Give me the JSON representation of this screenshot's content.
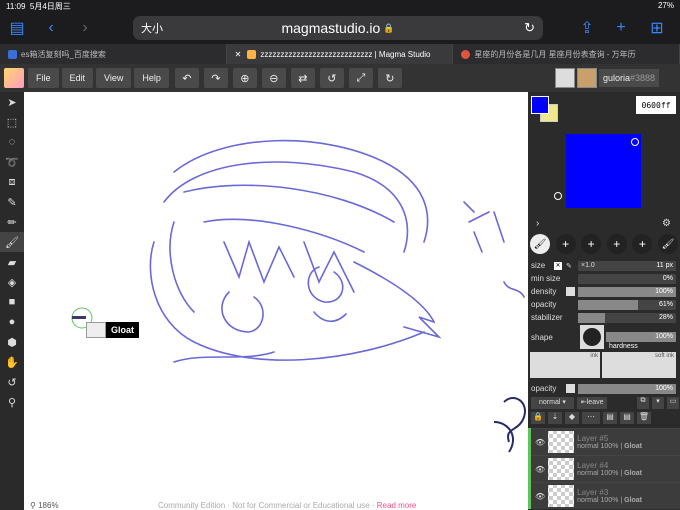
{
  "status": {
    "time": "11:09",
    "date": "5月4日周三",
    "battery": "27%"
  },
  "browser": {
    "aa": "大小",
    "url": "magmastudio.io",
    "tabs": [
      {
        "label": "es箱活复刻吗_百度搜索"
      },
      {
        "label": "zzzzzzzzzzzzzzzzzzzzzzzzzzzz | Magma Studio"
      },
      {
        "label": "星座的月份各是几月 星座月份表查询 - 万年历"
      }
    ]
  },
  "menu": {
    "file": "File",
    "edit": "Edit",
    "view": "View",
    "help": "Help"
  },
  "user": {
    "name": "guloria",
    "tag": "#3888"
  },
  "canvas": {
    "zoom": "186%",
    "footer": "Community Edition · Not for Commercial or Educational use ·",
    "read_more": "Read more",
    "cursor_label": "Gloat"
  },
  "colors": {
    "primary": "#0000ff",
    "secondary": "#f0e68c",
    "hex": "0600ff"
  },
  "brush": {
    "size_label": "size",
    "size_value": "×1.0",
    "size_px": "11 px",
    "min_size_label": "min size",
    "min_size_value": "0%",
    "min_size_pct": 0,
    "density_label": "density",
    "density_value": "100%",
    "density_pct": 100,
    "opacity_label": "opacity",
    "opacity_value": "61%",
    "opacity_pct": 61,
    "stabilizer_label": "stabilizer",
    "stabilizer_value": "28%",
    "stabilizer_pct": 28,
    "shape_label": "shape",
    "hardness_label": "hardness",
    "hardness_value": "100%",
    "ink_label": "ink",
    "soft_ink_label": "soft ink",
    "slots": [
      "1",
      "2",
      "3",
      "4",
      "5",
      "6"
    ]
  },
  "layer_controls": {
    "opacity_label": "opacity",
    "opacity_value": "100%",
    "mode": "normal",
    "leave": "leave"
  },
  "layers": [
    {
      "name": "Layer #5",
      "mode": "normal 100%",
      "owner": "Gloat"
    },
    {
      "name": "Layer #4",
      "mode": "normal 100%",
      "owner": "Gloat"
    },
    {
      "name": "Layer #3",
      "mode": "normal 100%",
      "owner": "Gloat"
    }
  ]
}
